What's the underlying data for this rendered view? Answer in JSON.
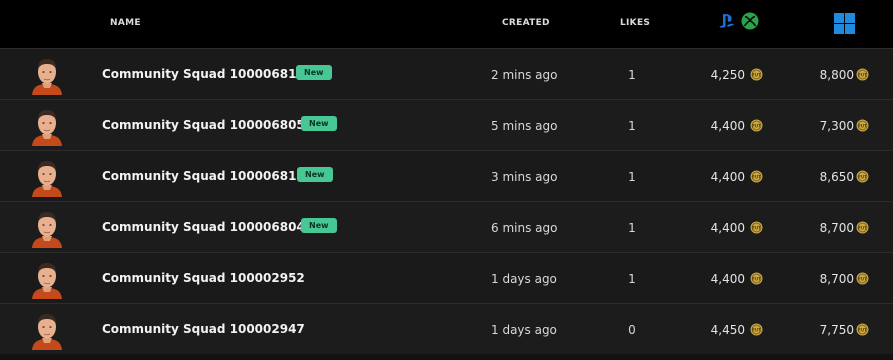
{
  "header": {
    "name_label": "NAME",
    "created_label": "CREATED",
    "likes_label": "LIKES",
    "console_icons": [
      "playstation-icon",
      "xbox-icon"
    ],
    "pc_icon": "windows-icon"
  },
  "rows": [
    {
      "name": "Community Squad 100006817",
      "badge": "New",
      "created": "2 mins ago",
      "likes": "1",
      "console_price": "4,250",
      "pc_price": "8,800"
    },
    {
      "name": "Community Squad 100006805",
      "badge": "New",
      "created": "5 mins ago",
      "likes": "1",
      "console_price": "4,400",
      "pc_price": "7,300"
    },
    {
      "name": "Community Squad 100006815",
      "badge": "New",
      "created": "3 mins ago",
      "likes": "1",
      "console_price": "4,400",
      "pc_price": "8,650"
    },
    {
      "name": "Community Squad 100006804",
      "badge": "New",
      "created": "6 mins ago",
      "likes": "1",
      "console_price": "4,400",
      "pc_price": "8,700"
    },
    {
      "name": "Community Squad 100002952",
      "badge": "",
      "created": "1 days ago",
      "likes": "1",
      "console_price": "4,400",
      "pc_price": "8,700"
    },
    {
      "name": "Community Squad 100002947",
      "badge": "",
      "created": "1 days ago",
      "likes": "0",
      "console_price": "4,450",
      "pc_price": "7,750"
    }
  ],
  "coin_icon": "fut-coin-icon",
  "colors": {
    "header_bg": "#000000",
    "row_bg": "#1c1c1c",
    "badge_bg": "#47c793",
    "coin": "#c9a646",
    "playstation": "#1b6fd6",
    "xbox": "#2aa34a",
    "windows": "#1f8be0"
  }
}
